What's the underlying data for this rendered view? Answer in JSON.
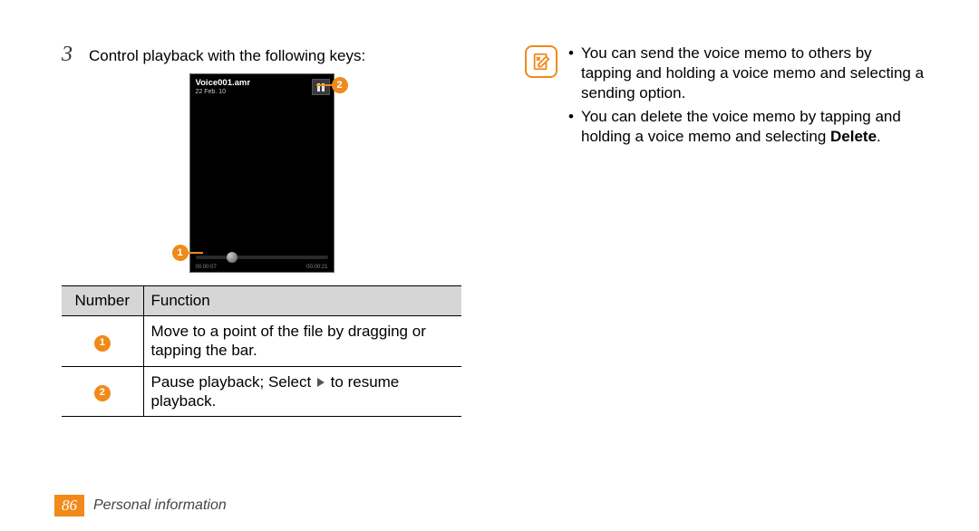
{
  "step": {
    "number": "3",
    "text": "Control playback with the following keys:"
  },
  "phone": {
    "filename": "Voice001.amr",
    "date": "22 Feb. 10",
    "time_current": "00:00:07",
    "time_total": "00:00:21"
  },
  "callouts": {
    "c1": "1",
    "c2": "2"
  },
  "table": {
    "headers": {
      "number": "Number",
      "function": "Function"
    },
    "rows": [
      {
        "num": "1",
        "func": "Move to a point of the file by dragging or tapping the bar."
      },
      {
        "num": "2",
        "func_pre": "Pause playback; Select ",
        "func_post": " to resume playback."
      }
    ]
  },
  "notes": {
    "item1": "You can send the voice memo to others by tapping and holding a voice memo and selecting a sending option.",
    "item2_pre": "You can delete the voice memo by tapping and holding a voice memo and selecting ",
    "item2_bold": "Delete",
    "item2_post": "."
  },
  "footer": {
    "page": "86",
    "section": "Personal information"
  }
}
